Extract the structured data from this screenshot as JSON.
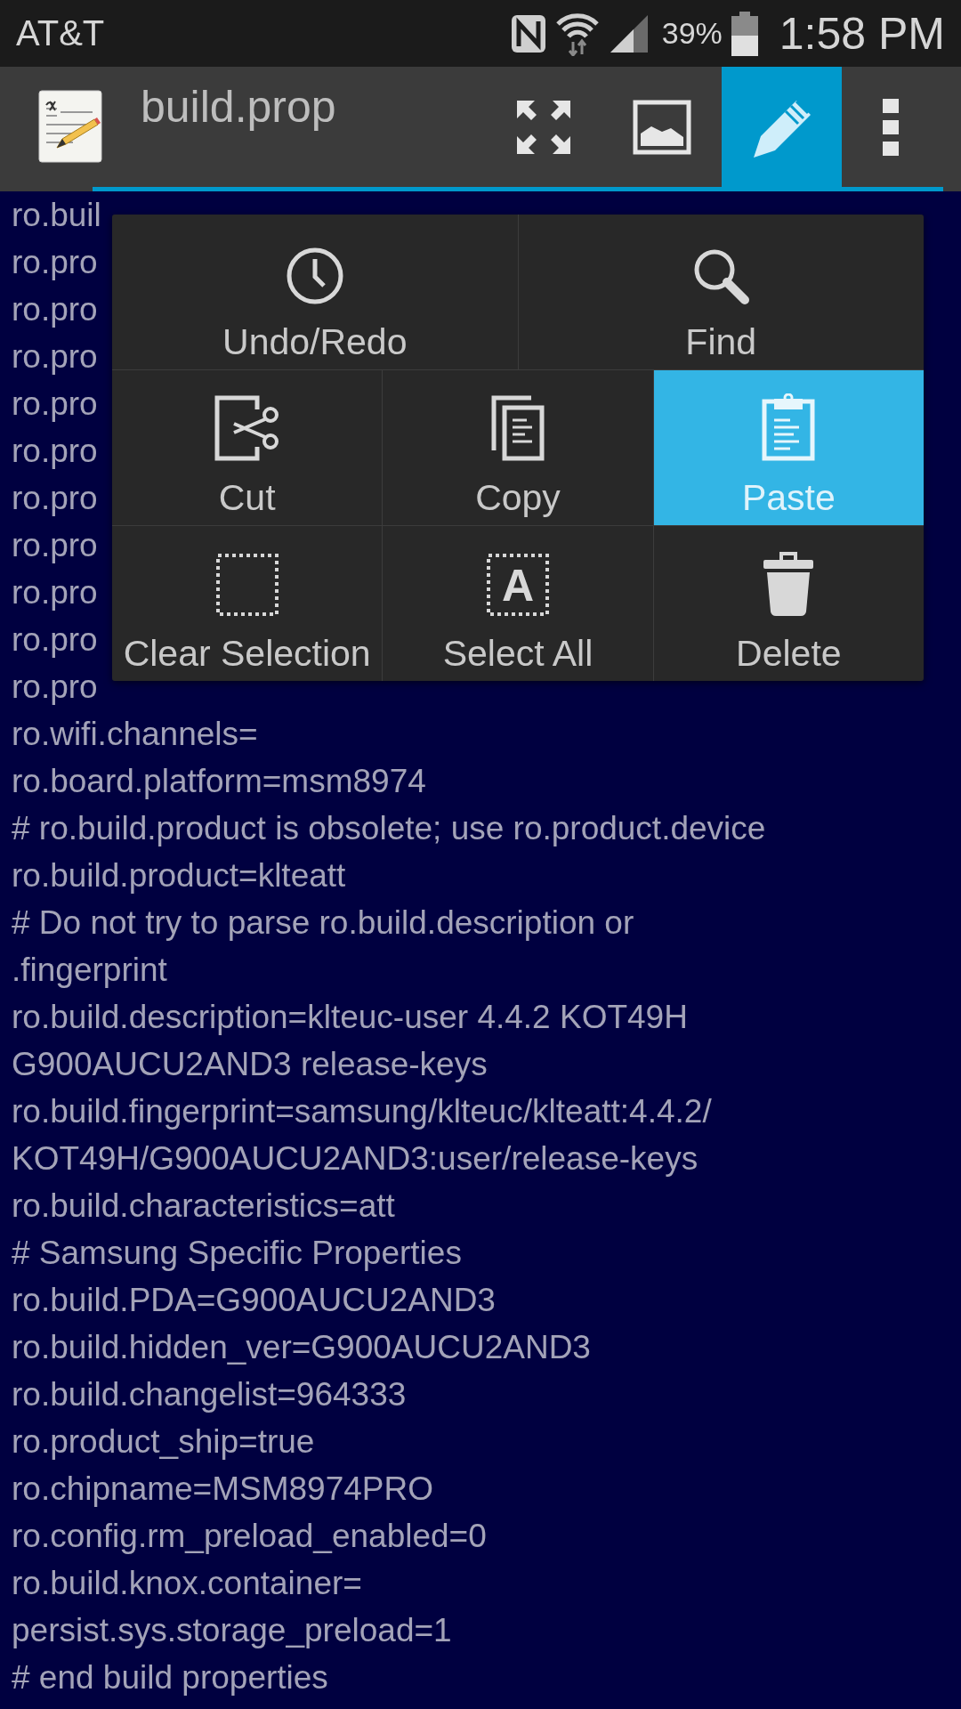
{
  "status_bar": {
    "carrier": "AT&T",
    "battery": "39%",
    "time": "1:58 PM"
  },
  "toolbar": {
    "title": "build.prop",
    "actions": [
      {
        "kind": "fullscreen",
        "selected": false
      },
      {
        "kind": "image",
        "selected": false
      },
      {
        "kind": "edit",
        "selected": true
      },
      {
        "kind": "overflow",
        "selected": false
      }
    ]
  },
  "editor": {
    "lines": [
      "ro.buil",
      "ro.pro",
      "ro.pro",
      "ro.pro",
      "ro.pro",
      "ro.pro",
      "ro.pro",
      "ro.pro",
      "ro.pro",
      "ro.pro",
      "ro.pro",
      "ro.wifi.channels=",
      "ro.board.platform=msm8974",
      "# ro.build.product is obsolete; use ro.product.device",
      "ro.build.product=klteatt",
      "# Do not try to parse ro.build.description or",
      ".fingerprint",
      "ro.build.description=klteuc-user 4.4.2 KOT49H",
      "G900AUCU2AND3 release-keys",
      "ro.build.fingerprint=samsung/klteuc/klteatt:4.4.2/",
      "KOT49H/G900AUCU2AND3:user/release-keys",
      "ro.build.characteristics=att",
      "# Samsung Specific Properties",
      "ro.build.PDA=G900AUCU2AND3",
      "ro.build.hidden_ver=G900AUCU2AND3",
      "ro.build.changelist=964333",
      "ro.product_ship=true",
      "ro.chipname=MSM8974PRO",
      "ro.config.rm_preload_enabled=0",
      "ro.build.knox.container=",
      "persist.sys.storage_preload=1",
      "# end build properties"
    ]
  },
  "popup": {
    "rows": [
      [
        {
          "kind": "undo",
          "label": "Undo/Redo",
          "selected": false
        },
        {
          "kind": "find",
          "label": "Find",
          "selected": false
        }
      ],
      [
        {
          "kind": "cut",
          "label": "Cut",
          "selected": false
        },
        {
          "kind": "copy",
          "label": "Copy",
          "selected": false
        },
        {
          "kind": "paste",
          "label": "Paste",
          "selected": true
        }
      ],
      [
        {
          "kind": "clear",
          "label": "Clear Selection",
          "selected": false
        },
        {
          "kind": "selectall",
          "label": "Select All",
          "icon_letter": "A",
          "selected": false
        },
        {
          "kind": "delete",
          "label": "Delete",
          "selected": false
        }
      ]
    ]
  }
}
